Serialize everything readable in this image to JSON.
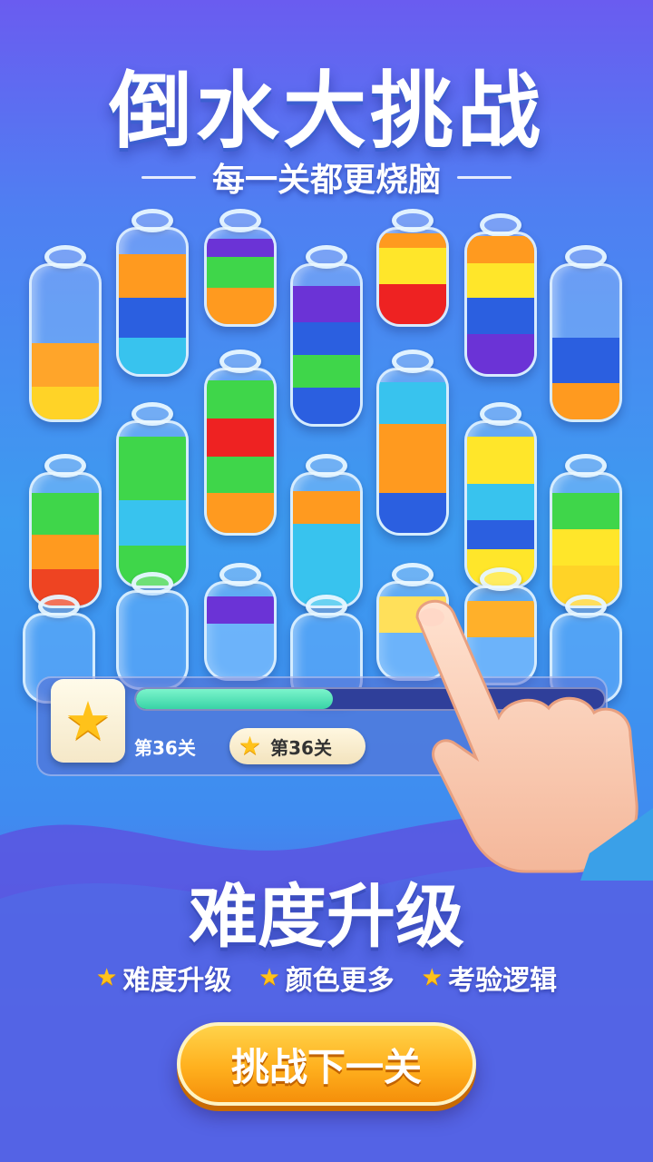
{
  "header": {
    "title": "倒水大挑战",
    "subtitle": "每一关都更烧脑"
  },
  "colors": {
    "orange": "#ff9a1f",
    "yellow": "#ffe62a",
    "green": "#3fd64a",
    "blue": "#2b5fe0",
    "light_blue": "#38c3ee",
    "red": "#ee2222",
    "purple": "#6b33d6",
    "accent": "#ffc21a"
  },
  "progress": {
    "fill_fraction": 0.42,
    "level_label": "第36关",
    "pill_label": "第36关"
  },
  "section": {
    "title": "难度升级"
  },
  "features": [
    {
      "icon": "star-icon",
      "label": "难度升级"
    },
    {
      "icon": "star-icon",
      "label": "颜色更多"
    },
    {
      "icon": "star-icon",
      "label": "考验逻辑"
    }
  ],
  "cta": {
    "label": "挑战下一关"
  }
}
